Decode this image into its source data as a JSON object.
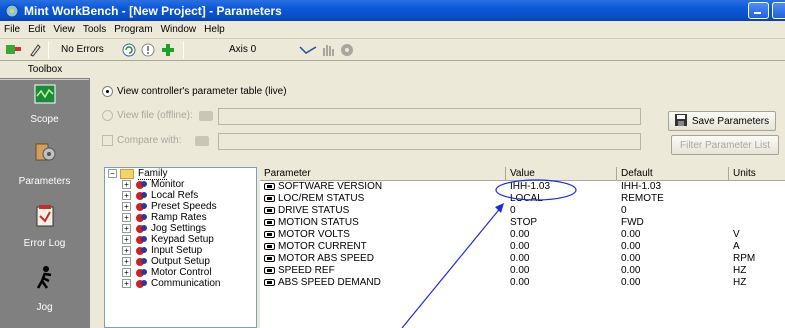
{
  "window": {
    "title": "Mint WorkBench - [New Project] - Parameters",
    "controls": [
      "minimize-icon",
      "maximize-icon"
    ]
  },
  "menu": [
    "File",
    "Edit",
    "View",
    "Tools",
    "Program",
    "Window",
    "Help"
  ],
  "toolbar": {
    "status": "No Errors",
    "axis": "Axis 0",
    "icons": [
      "plug-icon",
      "eraser-icon",
      "refresh-icon",
      "info-icon",
      "add-icon",
      "axis-move-icon",
      "hand-icon",
      "disc-icon"
    ]
  },
  "toolbox": {
    "title": "Toolbox",
    "items": [
      {
        "label": "Scope",
        "icon": "scope-icon"
      },
      {
        "label": "Parameters",
        "icon": "parameters-icon"
      },
      {
        "label": "Error Log",
        "icon": "error-log-icon"
      },
      {
        "label": "Jog",
        "icon": "jog-icon"
      }
    ]
  },
  "options": {
    "live": "View controller's parameter table (live)",
    "offline": "View file (offline):",
    "compare": "Compare with:"
  },
  "buttons": {
    "save": "Save Parameters",
    "filter": "Filter Parameter List"
  },
  "tree": {
    "root": "Family",
    "items": [
      "Monitor",
      "Local Refs",
      "Preset Speeds",
      "Ramp Rates",
      "Jog Settings",
      "Keypad Setup",
      "Input Setup",
      "Output Setup",
      "Motor Control",
      "Communication"
    ]
  },
  "grid": {
    "columns": [
      "Parameter",
      "Value",
      "Default",
      "Units"
    ],
    "rows": [
      {
        "parameter": "SOFTWARE VERSION",
        "value": "IHH-1.03",
        "default": "IHH-1.03",
        "units": ""
      },
      {
        "parameter": "LOC/REM STATUS",
        "value": "LOCAL",
        "default": "REMOTE",
        "units": ""
      },
      {
        "parameter": "DRIVE STATUS",
        "value": "0",
        "default": "0",
        "units": ""
      },
      {
        "parameter": "MOTION STATUS",
        "value": "STOP",
        "default": "FWD",
        "units": ""
      },
      {
        "parameter": "MOTOR VOLTS",
        "value": "0.00",
        "default": "0.00",
        "units": "V"
      },
      {
        "parameter": "MOTOR CURRENT",
        "value": "0.00",
        "default": "0.00",
        "units": "A"
      },
      {
        "parameter": "MOTOR ABS SPEED",
        "value": "0.00",
        "default": "0.00",
        "units": "RPM"
      },
      {
        "parameter": "SPEED REF",
        "value": "0.00",
        "default": "0.00",
        "units": "HZ"
      },
      {
        "parameter": "ABS SPEED DEMAND",
        "value": "0.00",
        "default": "0.00",
        "units": "HZ"
      }
    ]
  },
  "colors": {
    "title_bar": "#0a58d8",
    "annotation": "#1c2fd6",
    "window_face": "#ece9d8",
    "toolbox_bg": "#808080"
  }
}
